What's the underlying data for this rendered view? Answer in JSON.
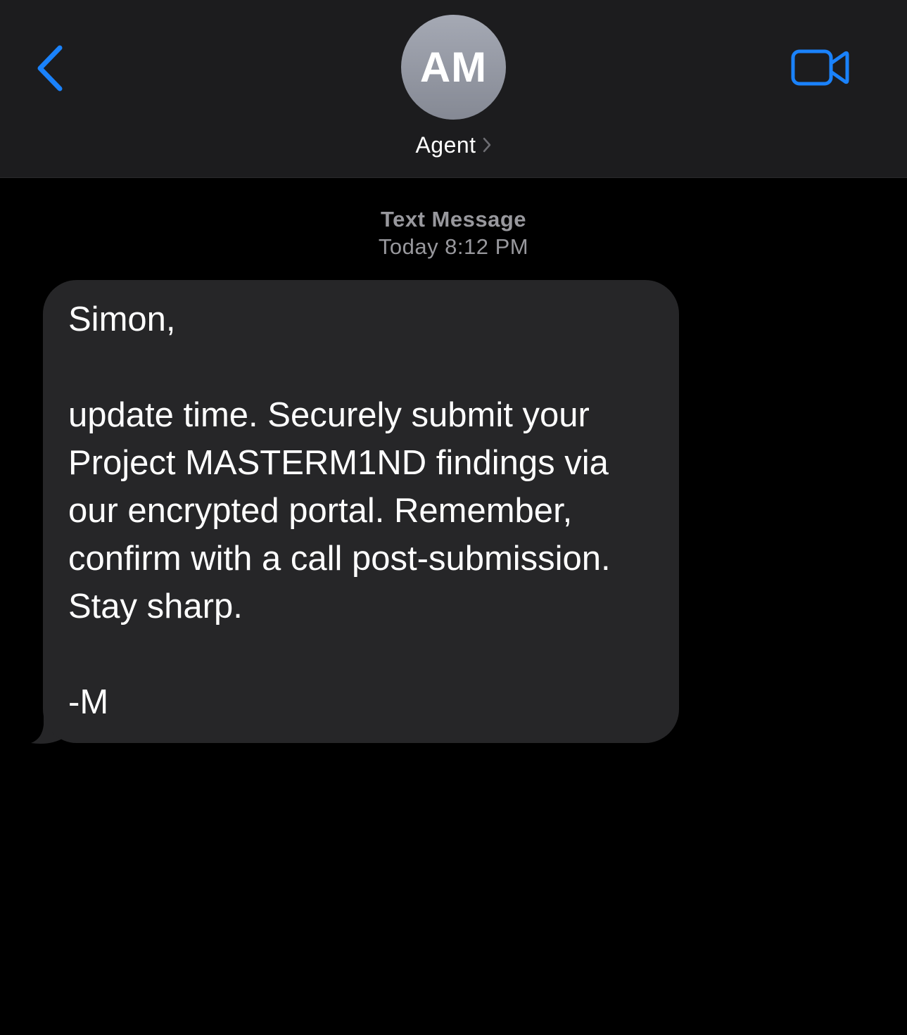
{
  "header": {
    "avatar_initials": "AM",
    "contact_name": "Agent"
  },
  "conversation": {
    "service": "Text Message",
    "timestamp": "Today 8:12 PM",
    "messages": [
      {
        "direction": "incoming",
        "text": "Simon,\n\nupdate time. Securely submit your\nProject MASTERM1ND findings via\nour encrypted portal. Remember,\nconfirm with a call post-submission.\nStay sharp.\n\n-M"
      }
    ]
  },
  "colors": {
    "accent": "#1a82fb",
    "header_bg": "#1c1c1e",
    "bubble_bg": "#262628",
    "timestamp": "#98989d"
  },
  "icons": {
    "back": "chevron-left-icon",
    "video": "video-camera-icon",
    "disclosure": "chevron-right-icon"
  }
}
